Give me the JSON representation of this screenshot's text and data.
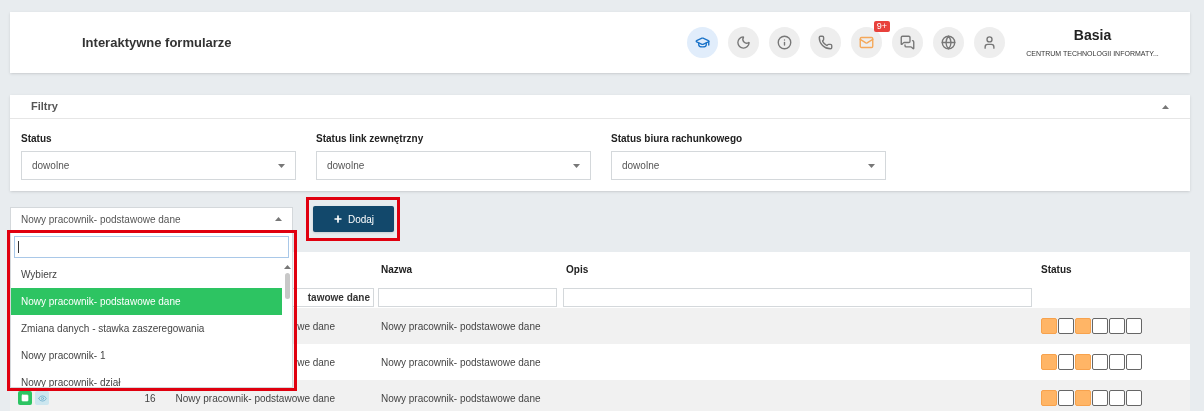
{
  "header": {
    "title": "Interaktywne formularze",
    "user_name": "Basia",
    "organization": "CENTRUM TECHNOLOGII INFORMATY...",
    "icons": [
      {
        "kind": "education",
        "selected": true
      },
      {
        "kind": "moon",
        "selected": false
      },
      {
        "kind": "info",
        "selected": false
      },
      {
        "kind": "phone",
        "selected": false
      },
      {
        "kind": "mail",
        "selected": false,
        "badge": "9+"
      },
      {
        "kind": "chat",
        "selected": false
      },
      {
        "kind": "globe",
        "selected": false
      },
      {
        "kind": "user",
        "selected": false
      }
    ]
  },
  "filters": {
    "title": "Filtry",
    "expanded": true,
    "fields": [
      {
        "label": "Status",
        "value": "dowolne"
      },
      {
        "label": "Status link zewnętrzny",
        "value": "dowolne"
      },
      {
        "label": "Status biura rachunkowego",
        "value": "dowolne"
      }
    ]
  },
  "form_select": {
    "value": "Nowy pracownik- podstawowe dane",
    "expanded": true,
    "options": [
      {
        "label": "Wybierz",
        "selected": false
      },
      {
        "label": "Nowy pracownik- podstawowe dane",
        "selected": true
      },
      {
        "label": "Zmiana danych - stawka zaszeregowania",
        "selected": false
      },
      {
        "label": "Nowy pracownik- 1",
        "selected": false
      },
      {
        "label": "Nowy pracownik- dział",
        "selected": false
      }
    ]
  },
  "add_button": "Dodaj",
  "table": {
    "headers": {
      "name": "Nazwa",
      "description": "Opis",
      "status": "Status"
    },
    "filter_row": {
      "column_3": "tawowe dane"
    },
    "rows": [
      {
        "column_3": "we dane",
        "name": "Nowy pracownik- podstawowe dane",
        "status": [
          {
            "checked": true
          },
          {
            "checked": false
          },
          {
            "checked": true
          },
          {
            "checked": false
          },
          {
            "checked": false
          },
          {
            "checked": false
          }
        ]
      },
      {
        "column_3": "we dane",
        "name": "Nowy pracownik- podstawowe dane",
        "status": [
          {
            "checked": true
          },
          {
            "checked": false
          },
          {
            "checked": true
          },
          {
            "checked": false
          },
          {
            "checked": false
          },
          {
            "checked": false
          }
        ]
      },
      {
        "actions": [
          {
            "kind": "edit"
          },
          {
            "kind": "view"
          }
        ],
        "number": "16",
        "column_3": "Nowy pracownik- podstawowe dane",
        "name": "Nowy pracownik- podstawowe dane",
        "status": [
          {
            "checked": true
          },
          {
            "checked": false
          },
          {
            "checked": true
          },
          {
            "checked": false
          },
          {
            "checked": false
          },
          {
            "checked": false
          }
        ]
      }
    ]
  }
}
